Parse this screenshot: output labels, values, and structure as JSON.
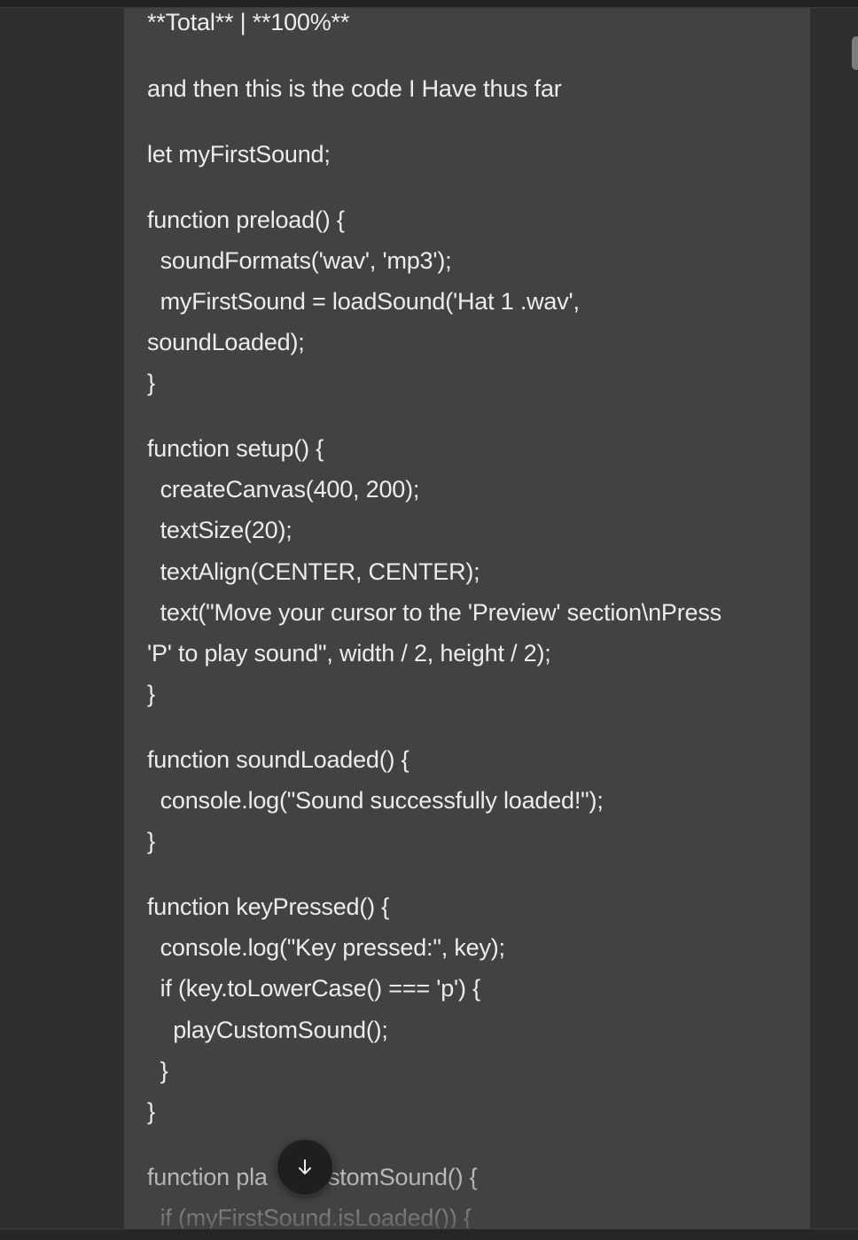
{
  "message": {
    "lines": [
      "**Total** | **100%**",
      "and then this is the code I Have thus far",
      "let myFirstSound;",
      "function preload() {",
      "  soundFormats('wav', 'mp3');",
      "  myFirstSound = loadSound('Hat 1 .wav',",
      "soundLoaded);",
      "}",
      "function setup() {",
      "  createCanvas(400, 200);",
      "  textSize(20);",
      "  textAlign(CENTER, CENTER);",
      "  text(\"Move your cursor to the 'Preview' section\\nPress",
      "'P' to play sound\", width / 2, height / 2);",
      "}",
      "function soundLoaded() {",
      "  console.log(\"Sound successfully loaded!\");",
      "}",
      "function keyPressed() {",
      "  console.log(\"Key pressed:\", key);",
      "  if (key.toLowerCase() === 'p') {",
      "    playCustomSound();",
      "  }",
      "}",
      "function pla",
      "stomSound() {",
      "  if (myFirstSound.isLoaded()) {"
    ]
  },
  "scroll_button": {
    "icon": "arrow-down-icon"
  },
  "colors": {
    "page_background": "#2f2f2f",
    "message_background": "#424242",
    "text": "#ececec",
    "button_background": "#1f1f1f"
  }
}
